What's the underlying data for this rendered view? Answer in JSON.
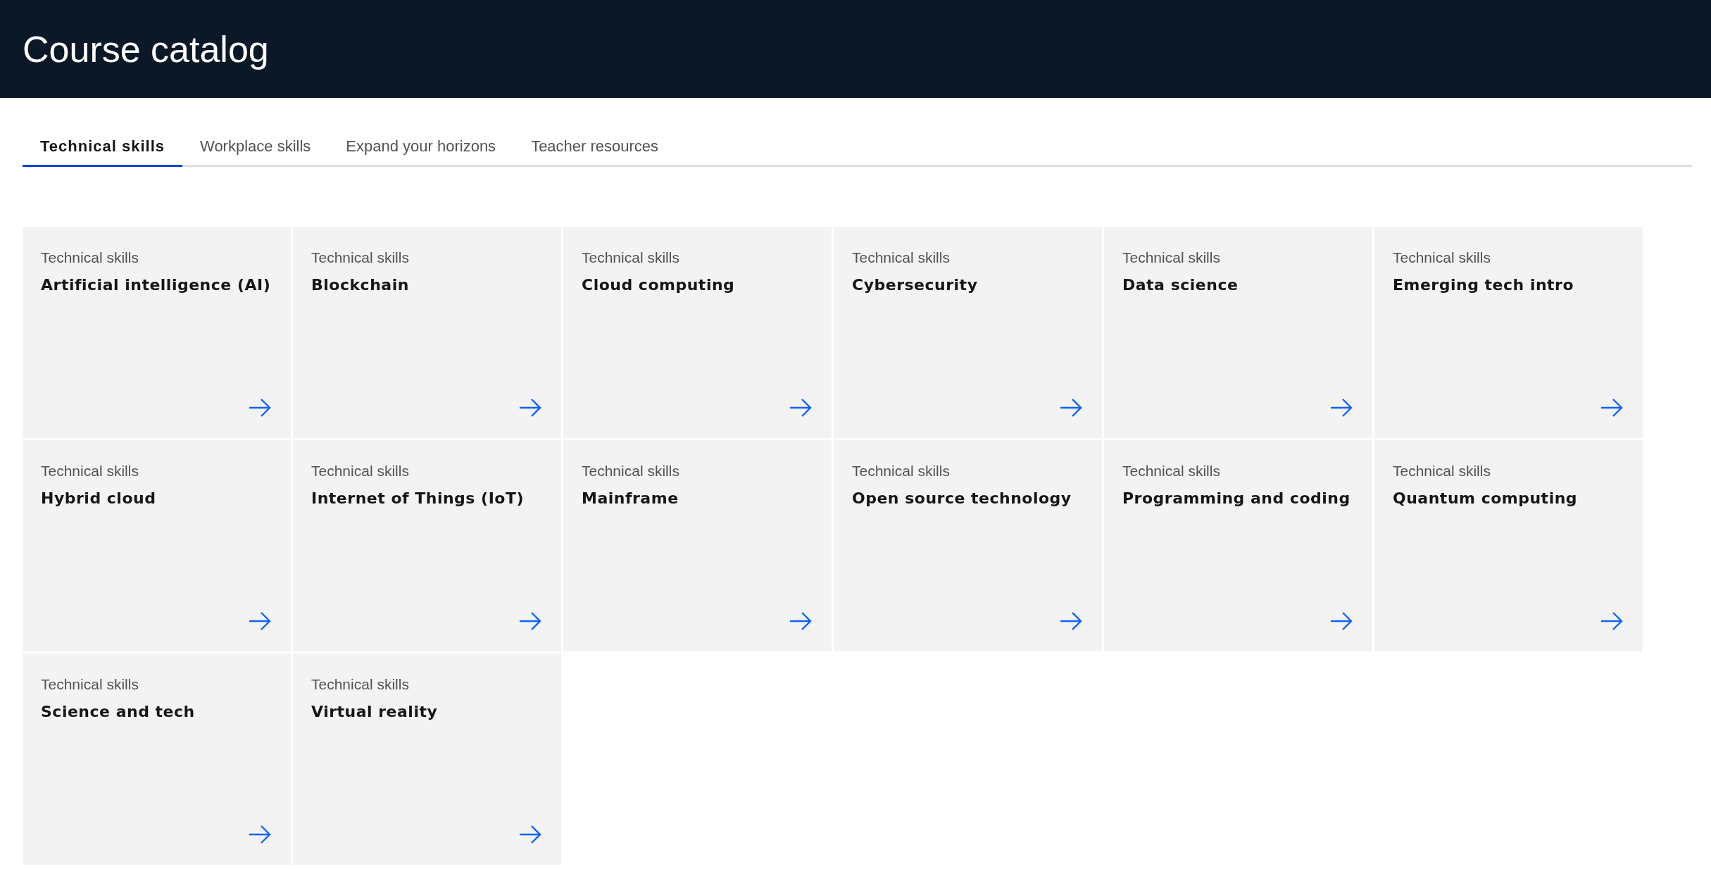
{
  "header": {
    "title": "Course catalog"
  },
  "tabs": [
    {
      "label": "Technical skills",
      "selected": true
    },
    {
      "label": "Workplace skills",
      "selected": false
    },
    {
      "label": "Expand your horizons",
      "selected": false
    },
    {
      "label": "Teacher resources",
      "selected": false
    }
  ],
  "cards": [
    {
      "category": "Technical skills",
      "title": "Artificial intelligence (AI)"
    },
    {
      "category": "Technical skills",
      "title": "Blockchain"
    },
    {
      "category": "Technical skills",
      "title": "Cloud computing"
    },
    {
      "category": "Technical skills",
      "title": "Cybersecurity"
    },
    {
      "category": "Technical skills",
      "title": "Data science"
    },
    {
      "category": "Technical skills",
      "title": "Emerging tech intro"
    },
    {
      "category": "Technical skills",
      "title": "Hybrid cloud"
    },
    {
      "category": "Technical skills",
      "title": "Internet of Things (IoT)"
    },
    {
      "category": "Technical skills",
      "title": "Mainframe"
    },
    {
      "category": "Technical skills",
      "title": "Open source technology"
    },
    {
      "category": "Technical skills",
      "title": "Programming and coding"
    },
    {
      "category": "Technical skills",
      "title": "Quantum computing"
    },
    {
      "category": "Technical skills",
      "title": "Science and tech"
    },
    {
      "category": "Technical skills",
      "title": "Virtual reality"
    }
  ]
}
